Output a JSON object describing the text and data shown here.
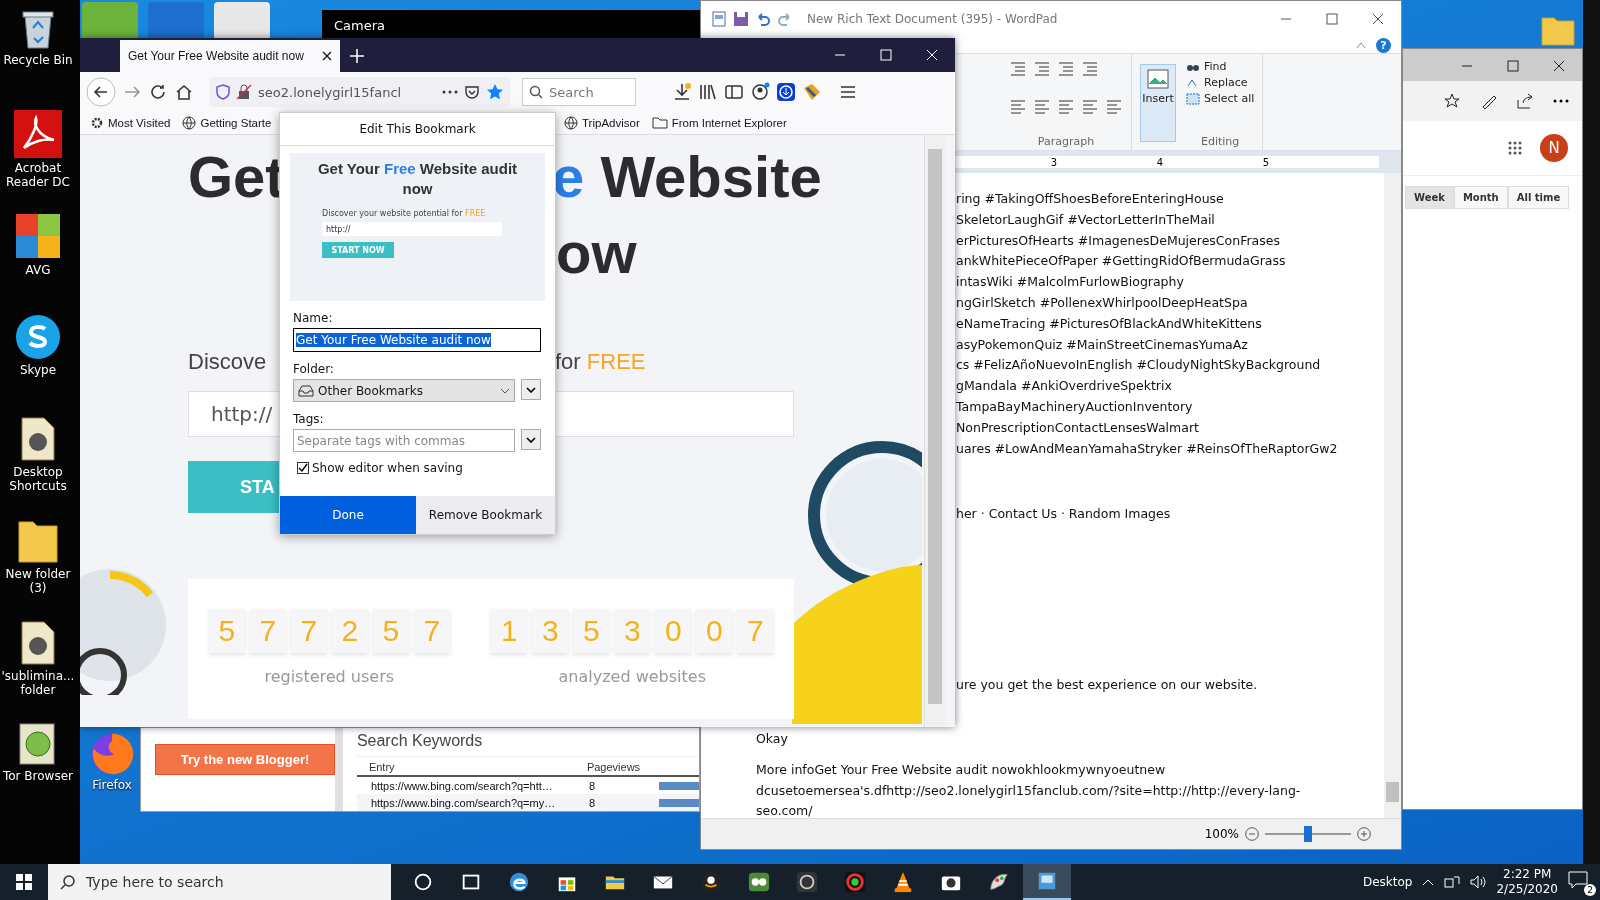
{
  "desktop_icons": [
    {
      "label": "Recycle Bin",
      "kind": "bin"
    },
    {
      "label": "Acrobat Reader DC",
      "kind": "pdf"
    },
    {
      "label": "AVG",
      "kind": "avg"
    },
    {
      "label": "Skype",
      "kind": "skype"
    },
    {
      "label": "Desktop Shortcuts",
      "kind": "file"
    },
    {
      "label": "New folder (3)",
      "kind": "folder"
    },
    {
      "label": "'sublimina... folder",
      "kind": "file"
    },
    {
      "label": "Tor Browser",
      "kind": "tor"
    }
  ],
  "desktop_shortcut": {
    "label": "Firefox"
  },
  "camera_window": {
    "title": "Camera"
  },
  "firefox": {
    "tab": {
      "title": "Get Your Free Website audit now",
      "selected": true
    },
    "url": "seo2.lonelygirl15fancl",
    "search": {
      "placeholder": "Search"
    },
    "bookmarks": [
      "Most Visited",
      "Getting Starte",
      "TripAdvisor",
      "From Internet Explorer"
    ],
    "page": {
      "headline_left": "Get",
      "headline_right": "e Website",
      "headline_line2": "ow",
      "discover_left": "Discove",
      "discover_right": "for",
      "discover_free": "FREE",
      "url_placeholder": "http://",
      "start_button": "STA",
      "counters": [
        {
          "digits": [
            "5",
            "7",
            "7",
            "2",
            "5",
            "7"
          ],
          "label": "registered users"
        },
        {
          "digits": [
            "1",
            "3",
            "5",
            "3",
            "0",
            "0",
            "7"
          ],
          "label": "analyzed websites"
        }
      ]
    }
  },
  "bookmark_popup": {
    "title": "Edit This Bookmark",
    "preview": {
      "title_start": "Get Your ",
      "title_free": "Free",
      "title_end": " Website audit now",
      "discover": "Discover your website potential for ",
      "discover_free": "FREE",
      "url_placeholder": "http://",
      "button": "START NOW"
    },
    "name_label": "Name:",
    "name_value": "Get Your Free Website audit now",
    "name_selected": true,
    "folder_label": "Folder:",
    "folder_value": "Other Bookmarks",
    "tags_label": "Tags:",
    "tags_placeholder": "Separate tags with commas",
    "show_editor": {
      "label": "Show editor when saving",
      "checked": true
    },
    "done_button": "Done",
    "remove_button": "Remove Bookmark"
  },
  "wordpad": {
    "title": "New Rich Text Document (395) - WordPad",
    "ribbon": {
      "help": "?",
      "paragraph_label": "Paragraph",
      "insert_label": "Insert",
      "find": "Find",
      "replace": "Replace",
      "select_all": "Select all",
      "editing_label": "Editing"
    },
    "ruler_numbers": [
      "3",
      "4",
      "5"
    ],
    "hashtag_lines": [
      "ring #TakingOffShoesBeforeEnteringHouse",
      "SkeletorLaughGif #VectorLetterInTheMail",
      "erPicturesOfHearts #ImagenesDeMujeresConFrases",
      "ankWhitePieceOfPaper #GettingRidOfBermudaGrass",
      "intasWiki #MalcolmFurlowBiography",
      "ngGirlSketch #PollenexWhirlpoolDeepHeatSpa",
      "eNameTracing #PicturesOfBlackAndWhiteKittens",
      "asyPokemonQuiz #MainStreetCinemasYumaAz",
      "cs #FelizAñoNuevoInEnglish #CloudyNightSkyBackground",
      "gMandala #AnkiOverdriveSpektrix",
      "TampaBayMachineryAuctionInventory",
      "NonPrescriptionContactLensesWalmart",
      "uares #LowAndMeanYamahaStryker #ReinsOfTheRaptorGw2"
    ],
    "footer_links": "her · Contact Us · Random Images",
    "cookie_notice": "ure you get the best experience on our website.",
    "okay": "Okay",
    "more_info_lines": [
      "More infoGet Your Free Website audit nowokhlookmywnyoeutnew",
      "dcusetoemersea's.dfhttp://seo2.lonelygirl15fanclub.com/?site=http://http://every-lang-",
      "seo.com/"
    ],
    "zoom": {
      "reading": "100%",
      "level": 0.5
    }
  },
  "edge_window": {
    "avatar": "N",
    "ranges": [
      {
        "label": "Week",
        "selected": true
      },
      {
        "label": "Month",
        "selected": false
      },
      {
        "label": "All time",
        "selected": false
      }
    ]
  },
  "blogger_window": {
    "button": "Try the new Blogger!",
    "heading": "Search Keywords",
    "columns": [
      "Entry",
      "Pageviews"
    ],
    "rows": [
      {
        "entry": "https://www.bing.com/search?q=htt…",
        "pageviews": "8"
      },
      {
        "entry": "https://www.bing.com/search?q=my…",
        "pageviews": "8"
      }
    ]
  },
  "taskbar": {
    "search_placeholder": "Type here to search",
    "apps": [
      {
        "selected": false
      },
      {
        "selected": false
      },
      {
        "selected": false
      },
      {
        "selected": false
      },
      {
        "selected": false
      },
      {
        "selected": false
      },
      {
        "selected": false
      },
      {
        "selected": false
      },
      {
        "selected": false
      },
      {
        "selected": false
      },
      {
        "selected": false
      },
      {
        "selected": false
      },
      {
        "selected": false
      },
      {
        "selected": true
      }
    ],
    "desktop_label": "Desktop",
    "time": "2:22 PM",
    "date": "2/25/2020",
    "notification_count": "2"
  }
}
